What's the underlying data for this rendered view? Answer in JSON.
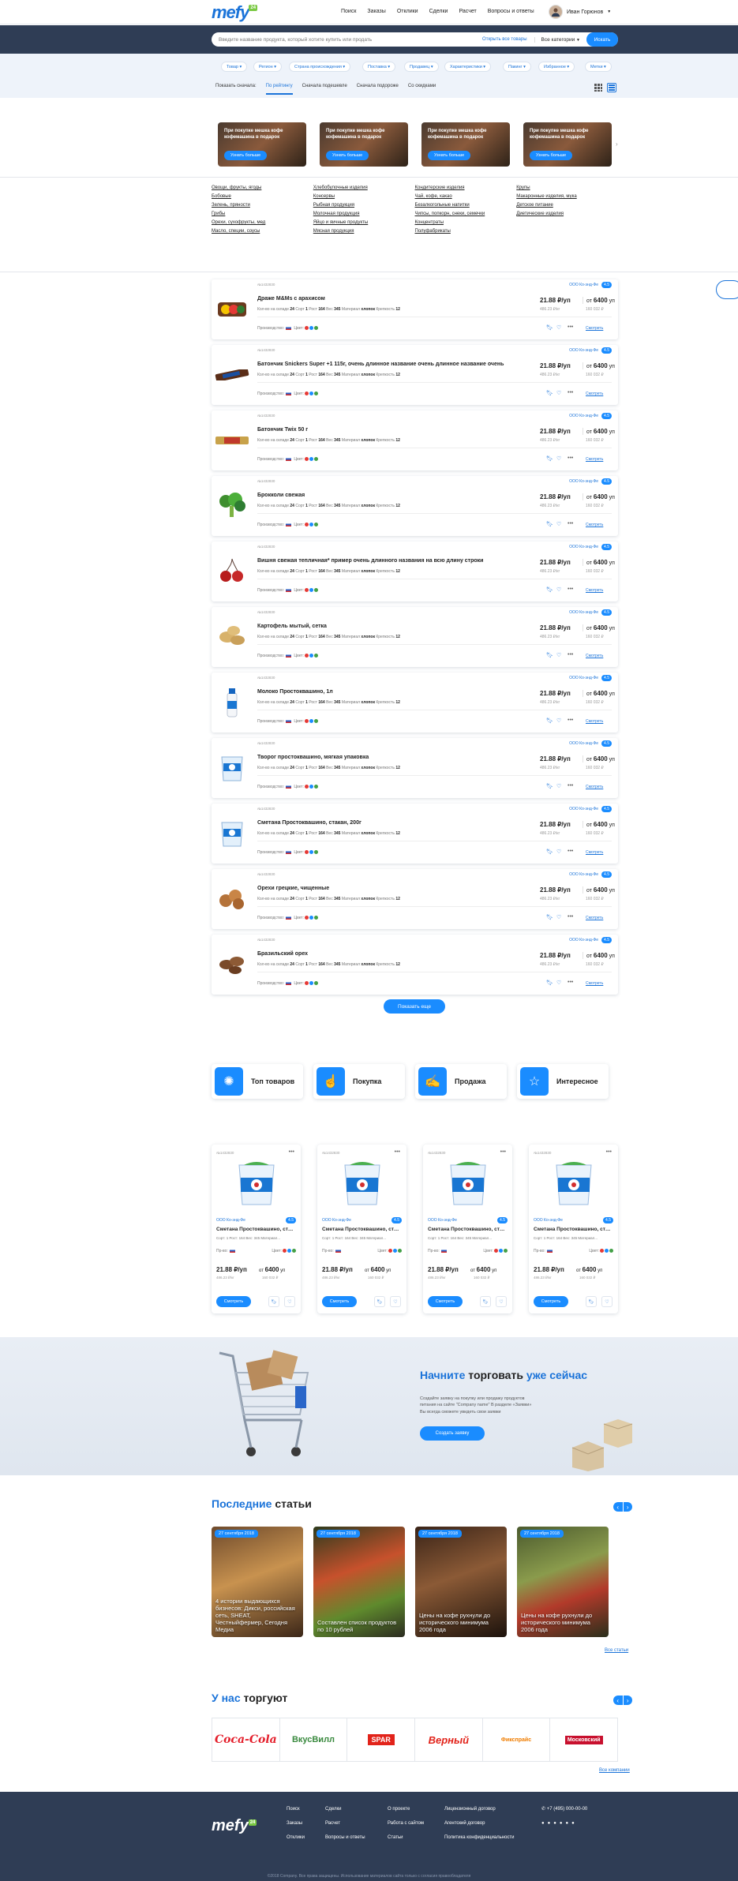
{
  "header": {
    "logo": "mefy",
    "logo_badge": "24",
    "nav": [
      "Поиск",
      "Заказы",
      "Отклики",
      "Сделки",
      "Расчет",
      "Вопросы и ответы"
    ],
    "user_name": "Иван Горюнов"
  },
  "search": {
    "placeholder": "Введите название продукта, который хотите купить или продать",
    "open_all": "Открыть все товары",
    "category": "Все категории",
    "button": "Искать"
  },
  "filters": [
    "Товар",
    "Регион",
    "Страна происхождения",
    "Поставка",
    "Продавец",
    "Характеристики",
    "Пакинг",
    "Избранное",
    "Метки"
  ],
  "sorts": [
    "Показать сначала:",
    "По рейтингу",
    "Сначала подешевле",
    "Сначала подороже",
    "Со скидками"
  ],
  "promo": {
    "title": "При покупке мешка кофе кофемашина в подарок",
    "button": "Узнать больше"
  },
  "categories": [
    "Овощи, фрукты, ягоды",
    "Хлебобулочные изделия",
    "Кондитерские изделия",
    "Крупы",
    "Бобовые",
    "Консервы",
    "Чай, кофе, какао",
    "Макаронные изделия, мука",
    "Зелень, пряности",
    "Рыбная продукция",
    "Безалкогольные напитки",
    "Детское питание",
    "Грибы",
    "Молочная продукция",
    "Чипсы, попкорн, снеки, семечки",
    "Диетические изделия",
    "Орехи, сухофрукты, мед",
    "Яйцо и яичные продукты",
    "Концентраты",
    "",
    "Масло, специи, соусы",
    "Мясная продукция",
    "Полуфабрикаты",
    ""
  ],
  "product_labels": {
    "art": "№1432830",
    "seller": "ООО Ко-энд-Фе",
    "rating": "4.5",
    "meta_stock": "Кол-во на складе",
    "meta_stock_v": "24",
    "meta_sort": "Сорт",
    "meta_sort_v": "1",
    "meta_height": "Рост",
    "meta_height_v": "164",
    "meta_weight": "Вес",
    "meta_weight_v": "345",
    "meta_material": "Материал",
    "meta_material_v": "хлопок",
    "meta_strength": "Крепкость",
    "meta_strength_v": "12",
    "producer": "Производство:",
    "color": "Цвет:",
    "price": "21.88 ₽/уп",
    "price_sub": "486.23 ₽/кг",
    "price_from": "от",
    "price2": "6400",
    "price2_unit": "уп",
    "price2_sub": "160 032 ₽",
    "view": "Смотреть"
  },
  "products": [
    {
      "name": "Драже M&Ms с арахисом"
    },
    {
      "name": "Батончик Snickers Super +1 115г, очень длинное название очень длинное название очень"
    },
    {
      "name": "Батончик Twix 50 г"
    },
    {
      "name": "Брокколи свежая"
    },
    {
      "name": "Вишня свежая тепличная* пример очень длинного названия на всю длину строки"
    },
    {
      "name": "Картофель мытый, сетка"
    },
    {
      "name": "Молоко Простоквашино, 1л"
    },
    {
      "name": "Творог простоквашино, мягкая упаковка"
    },
    {
      "name": "Сметана Простоквашино, стакан, 200г"
    },
    {
      "name": "Орехи грецкие, чищенные"
    },
    {
      "name": "Бразильский орех"
    }
  ],
  "show_more": "Показать еще",
  "tiles": [
    "Топ товаров",
    "Покупка",
    "Продажа",
    "Интересное"
  ],
  "cards": {
    "name": "Сметана Простоквашино, стакан, 200г",
    "meta": "Сорт: 1 Рост: 164 Вес: 345 Материал...",
    "producer": "Пр-во:",
    "color": "Цвет:",
    "button": "Смотреть"
  },
  "banner": {
    "title_a": "Начните",
    "title_b": "торговать",
    "title_c": "уже сейчас",
    "text": "Создайте заявку на покупку или продажу продуктов питания на сайте \"Company name\" В разделе «Заявки» Вы всегда сможете увидеть свои заявки",
    "button": "Создать заявку"
  },
  "articles": {
    "title_a": "Последние",
    "title_b": "статьи",
    "items": [
      {
        "date": "27 сентября 2018",
        "title": "4 истории выдающихся бизнесов: Дикси, российская сеть, SHEAT, Честныйфермер, Сегодня Медиа"
      },
      {
        "date": "27 сентября 2018",
        "title": "Составлен список продуктов по 10 рублей"
      },
      {
        "date": "27 сентября 2018",
        "title": "Цены на кофе рухнули до исторического минимума 2006 года"
      },
      {
        "date": "27 сентября 2018",
        "title": "Цены на кофе рухнули до исторического минимума 2006 года"
      }
    ],
    "all": "Все статьи"
  },
  "partners": {
    "title_a": "У нас",
    "title_b": "торгуют",
    "logos": [
      "Coca-Cola",
      "ВкусВилл",
      "SPAR",
      "Верный",
      "Фикспрайс",
      "Московский"
    ],
    "all": "Все компании"
  },
  "footer": {
    "col1": [
      "Поиск",
      "Заказы",
      "Отклики"
    ],
    "col2": [
      "Сделки",
      "Расчет",
      "Вопросы и ответы"
    ],
    "col3": [
      "О проекте",
      "Работа с сайтом",
      "Статьи"
    ],
    "col4": [
      "Лицензионный договор",
      "Агентский договор",
      "Политика конфиденциальности"
    ],
    "phone": "+7 (495) 000-00-00",
    "copyright": "©2018 Company. Все права защищены. Использование материалов сайта только с согласия правообладателя"
  }
}
